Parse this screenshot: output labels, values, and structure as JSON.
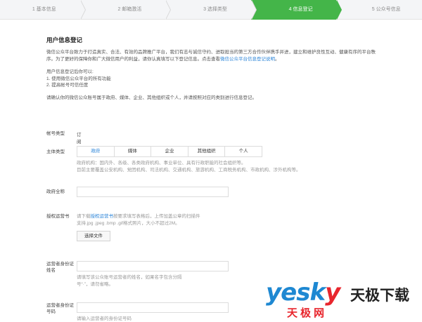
{
  "steps": [
    {
      "label": "1 基本信息",
      "active": false
    },
    {
      "label": "2 邮箱激活",
      "active": false
    },
    {
      "label": "3 选择类型",
      "active": false
    },
    {
      "label": "4 信息登记",
      "active": true
    },
    {
      "label": "5 公众号信息",
      "active": false
    }
  ],
  "main": {
    "title": "用户信息登记",
    "intro": "微信公众平台致力于打造真实、合法、有效的品牌推广平台，我们有志与诚信守约、进取担当的第三方合作伙伴携手并进，建立和维护良性互动、健康有序的平台秩序。为了更好的保障你和广大微信用户的利益，请你认真填写以下登记信息。点击查看",
    "intro_link": "微信公众平台信息登记说明",
    "intro_end": "。",
    "after_title": "用户信息登记后你可以:",
    "after_items": [
      "1. 使用微信公众平台的所有功能",
      "2. 提高帐号可信任度"
    ],
    "notice": "请确认你的微信公众账号属于政府、媒体、企业、其他组织或个人，并请按照对应的类别进行信息登记。"
  },
  "form": {
    "account_type_label": "帐号类型",
    "account_type_value": "订阅号",
    "subject_type_label": "主体类型",
    "subject_types": [
      "政府",
      "媒体",
      "企业",
      "其他组织",
      "个人"
    ],
    "subject_selected": "政府",
    "subject_hint_1": "政府机构：国内外、各级、各类政府机构、事业单位、具有行政职能的社会组织等。",
    "subject_hint_2": "目前主要覆盖公安机构、党团机构、司法机构、交通机构、旅游机构、工商税务机构、市政机构、涉外机构等。",
    "gov_name_label": "政府全称",
    "auth_label": "授权运营书",
    "auth_hint_pre": "请下载",
    "auth_hint_link": "授权运营书",
    "auth_hint_post": "按要求填写表格后，上传加盖公章的扫描件",
    "auth_hint_2": "支持.jpg .jpeg .bmp .gif格式照片，大小不超过2M。",
    "select_file": "选择文件",
    "operator_name_label": "运营者身份证姓名",
    "operator_name_hint_1": "请填写该公众账号运营者的姓名，如果名字包含分隔",
    "operator_name_hint_2": "号“·”，请勿省略。",
    "operator_id_label": "运营者身份证号码",
    "operator_id_hint": "请输入运营者的身份证号码"
  },
  "watermark": {
    "brand_blue": "yesk",
    "brand_red": "y",
    "brand_cn": "天极下载",
    "brand_net": "天极网"
  },
  "colors": {
    "accent": "#44b549",
    "link": "#2c85d8"
  }
}
